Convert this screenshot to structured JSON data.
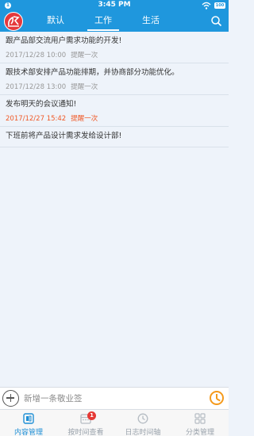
{
  "statusbar": {
    "notification_badge": "1",
    "time": "3:45 PM",
    "battery": "100"
  },
  "header": {
    "tabs": [
      {
        "label": "默认",
        "active": false
      },
      {
        "label": "工作",
        "active": true
      },
      {
        "label": "生活",
        "active": false
      }
    ]
  },
  "notes": [
    {
      "content": "跟产品部交流用户需求功能的开发!",
      "date": "2017/12/28 10:00",
      "remind": "提醒一次",
      "urgent": false
    },
    {
      "content": "跟技术部安排产品功能排期，并协商部分功能优化。",
      "date": "2017/12/28 13:00",
      "remind": "提醒一次",
      "urgent": false
    },
    {
      "content": "发布明天的会议通知!",
      "date": "2017/12/27 15:42",
      "remind": "提醒一次",
      "urgent": true
    },
    {
      "content": "下班前将产品设计需求发给设计部!"
    }
  ],
  "input": {
    "placeholder": "新增一条敬业签"
  },
  "nav": {
    "items": [
      {
        "label": "内容管理",
        "active": true
      },
      {
        "label": "按时间查看",
        "badge": "1"
      },
      {
        "label": "日志时间轴"
      },
      {
        "label": "分类管理"
      }
    ]
  },
  "colors": {
    "primary": "#1f97dd",
    "urgent": "#f05a28",
    "accent_orange": "#f59a1c",
    "badge": "#e53935"
  }
}
